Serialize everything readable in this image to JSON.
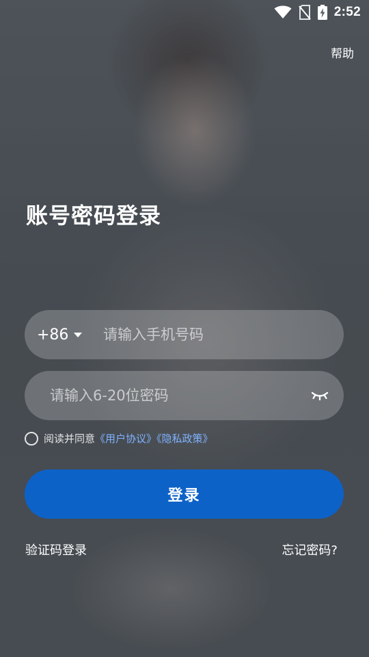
{
  "status_bar": {
    "time": "2:52",
    "icons": [
      "wifi-icon",
      "no-sim-icon",
      "battery-charging-icon"
    ]
  },
  "header": {
    "help_label": "帮助"
  },
  "title": "账号密码登录",
  "phone": {
    "country_code": "+86",
    "placeholder": "请输入手机号码",
    "value": ""
  },
  "password": {
    "placeholder": "请输入6-20位密码",
    "value": "",
    "toggle_icon": "eye-closed-icon"
  },
  "agreement": {
    "checked": false,
    "prefix": "阅读并同意",
    "user_agreement": "《用户协议》",
    "privacy_policy": "《隐私政策》"
  },
  "login_button": "登录",
  "links": {
    "sms_login": "验证码登录",
    "forgot_password": "忘记密码?"
  },
  "colors": {
    "primary": "#0d62c8",
    "link": "#7fb2ff"
  }
}
